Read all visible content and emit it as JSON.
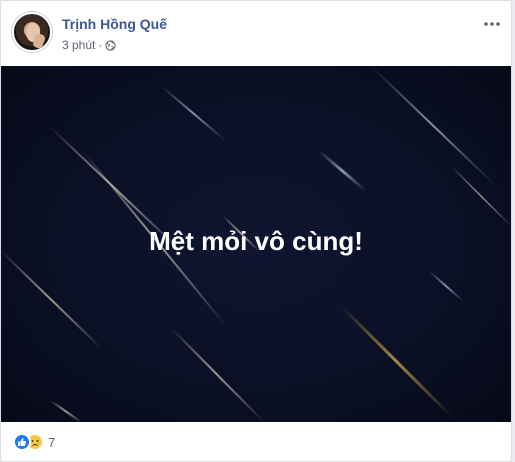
{
  "post": {
    "author_name": "Trịnh Hồng Quế",
    "timestamp": "3 phút",
    "separator": "·",
    "privacy_icon": "globe-icon",
    "more_icon": "more-options-icon"
  },
  "photo": {
    "text": "Mệt mỏi vô cùng!",
    "background_color": "#0b1026"
  },
  "reactions": {
    "icons": [
      "like-icon",
      "sad-icon"
    ],
    "count": "7"
  },
  "colors": {
    "name_link": "#385898",
    "meta_text": "#606770",
    "like_blue": "#2078f4",
    "sad_yellow": "#f7c945"
  }
}
